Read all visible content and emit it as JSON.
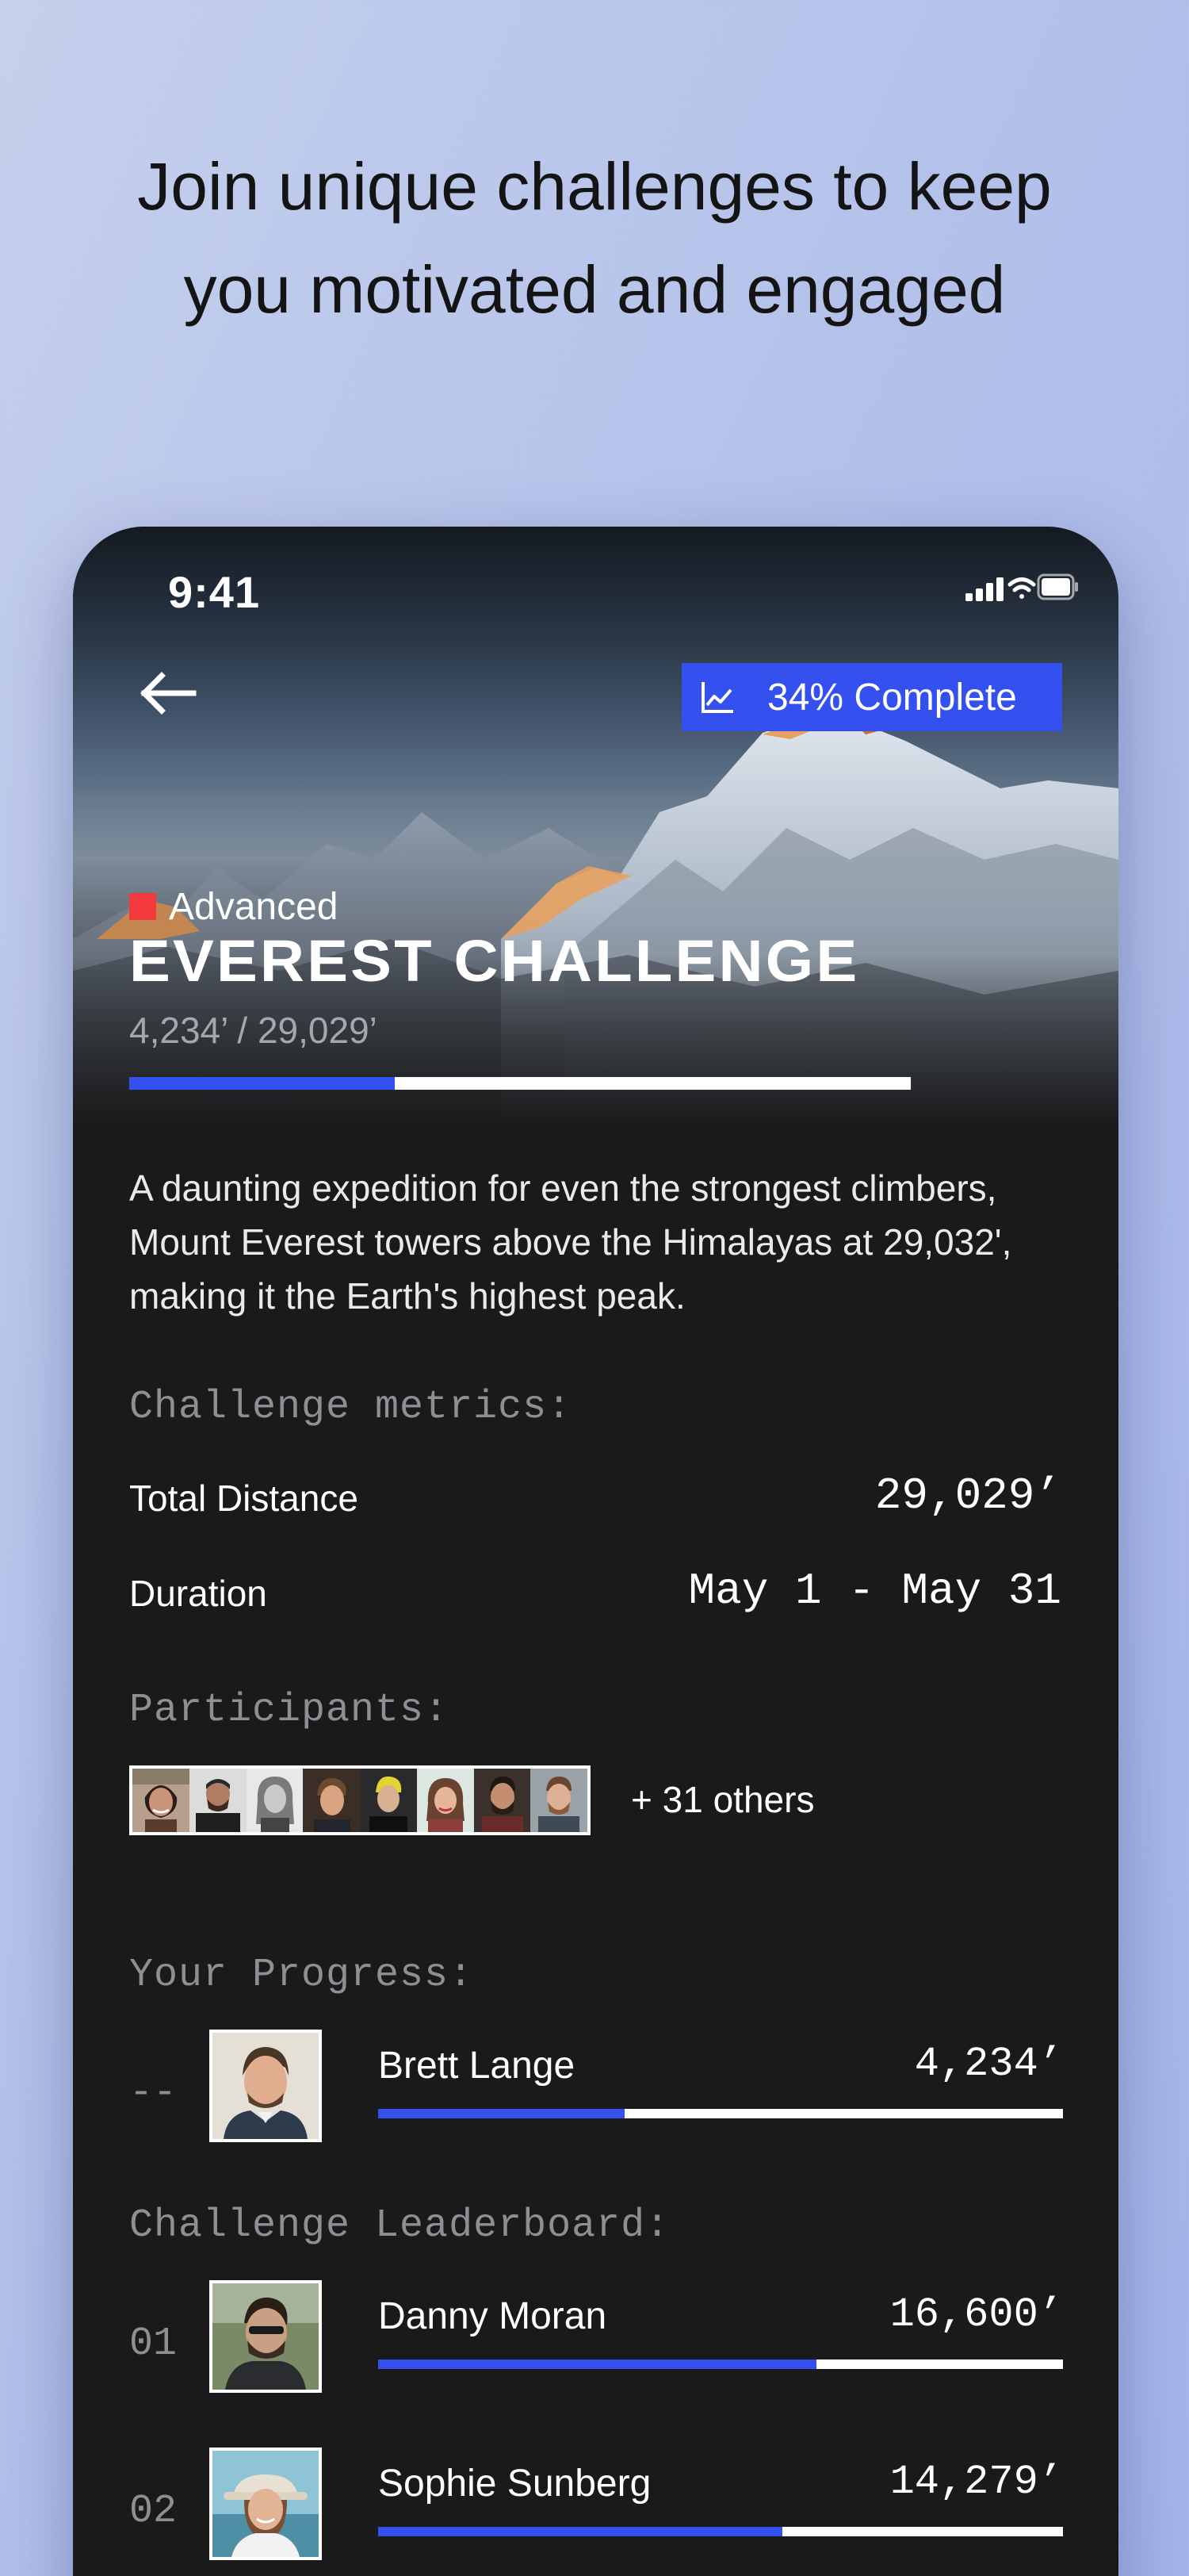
{
  "headline": {
    "line1": "Join unique challenges to keep",
    "line2": "you motivated and engaged"
  },
  "status_bar": {
    "time": "9:41",
    "icons": [
      "cellular-signal-icon",
      "wifi-icon",
      "battery-icon"
    ]
  },
  "header": {
    "back_icon": "arrow-left-icon",
    "badge_icon": "line-chart-icon",
    "complete_label": "34% Complete",
    "complete_fraction": 0.34
  },
  "challenge": {
    "level": "Advanced",
    "title": "EVEREST CHALLENGE",
    "elevation": "4,234’ / 29,029’",
    "progress_fraction": 0.34,
    "description": "A daunting expedition for even the strongest climbers, Mount Everest towers above the Himalayas at 29,032', making it the Earth's highest peak."
  },
  "metrics": {
    "label": "Challenge metrics:",
    "total_distance_label": "Total Distance",
    "total_distance_value": "29,029’",
    "duration_label": "Duration",
    "duration_value": "May 1 - May 31"
  },
  "participants": {
    "label": "Participants:",
    "others": "+ 31 others",
    "avatar_count": 8
  },
  "your_progress": {
    "label": "Your Progress:",
    "rank": "--",
    "name": "Brett Lange",
    "distance": "4,234’",
    "fraction": 0.36
  },
  "leaderboard": {
    "label": "Challenge Leaderboard:",
    "entries": [
      {
        "rank": "01",
        "name": "Danny Moran",
        "distance": "16,600’",
        "fraction": 0.64
      },
      {
        "rank": "02",
        "name": "Sophie Sunberg",
        "distance": "14,279’",
        "fraction": 0.59
      }
    ]
  },
  "colors": {
    "accent": "#3451f0",
    "level_marker": "#f2393b",
    "app_background": "#1a1a1b",
    "page_background": "#b1bfea"
  }
}
